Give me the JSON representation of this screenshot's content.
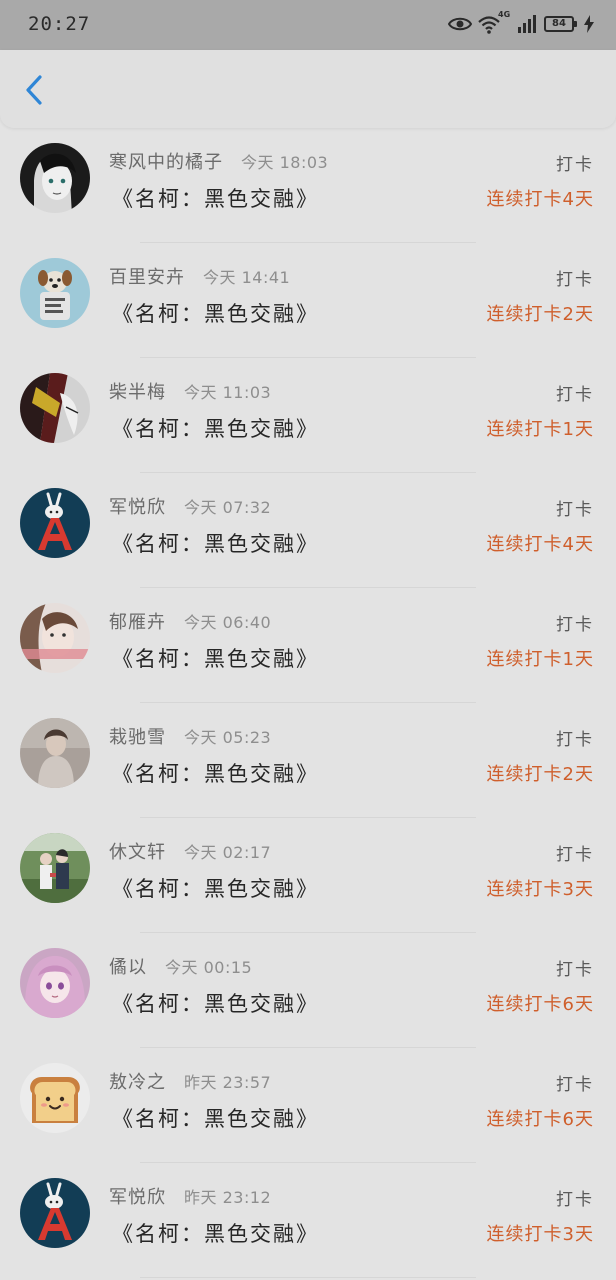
{
  "status_bar": {
    "time": "20:27",
    "network": "4G",
    "battery": "84",
    "icons": [
      "eye-icon",
      "wifi-icon",
      "signal-icon",
      "battery-icon",
      "charging-icon"
    ]
  },
  "header": {
    "back_icon": "chevron-left-icon",
    "accent_color": "#2f86d6"
  },
  "list": {
    "items": [
      {
        "name": "寒风中的橘子",
        "time": "今天 18:03",
        "book": "《名柯：黑色交融》",
        "action": "打卡",
        "streak": "连续打卡4天",
        "avatar": "avatar-anime-dark-hair"
      },
      {
        "name": "百里安卉",
        "time": "今天 14:41",
        "book": "《名柯：黑色交融》",
        "action": "打卡",
        "streak": "连续打卡2天",
        "avatar": "avatar-dog"
      },
      {
        "name": "柴半梅",
        "time": "今天 11:03",
        "book": "《名柯：黑色交融》",
        "action": "打卡",
        "streak": "连续打卡1天",
        "avatar": "avatar-mask-art"
      },
      {
        "name": "军悦欣",
        "time": "今天 07:32",
        "book": "《名柯：黑色交融》",
        "action": "打卡",
        "streak": "连续打卡4天",
        "avatar": "avatar-letter-a"
      },
      {
        "name": "郁雁卉",
        "time": "今天 06:40",
        "book": "《名柯：黑色交融》",
        "action": "打卡",
        "streak": "连续打卡1天",
        "avatar": "avatar-girl-pink"
      },
      {
        "name": "栽驰雪",
        "time": "今天 05:23",
        "book": "《名柯：黑色交融》",
        "action": "打卡",
        "streak": "连续打卡2天",
        "avatar": "avatar-girl-photo"
      },
      {
        "name": "休文轩",
        "time": "今天 02:17",
        "book": "《名柯：黑色交融》",
        "action": "打卡",
        "streak": "连续打卡3天",
        "avatar": "avatar-couple"
      },
      {
        "name": "僪以",
        "time": "今天 00:15",
        "book": "《名柯：黑色交融》",
        "action": "打卡",
        "streak": "连续打卡6天",
        "avatar": "avatar-anime-pink-hair"
      },
      {
        "name": "敖冷之",
        "time": "昨天 23:57",
        "book": "《名柯：黑色交融》",
        "action": "打卡",
        "streak": "连续打卡6天",
        "avatar": "avatar-toast"
      },
      {
        "name": "军悦欣",
        "time": "昨天 23:12",
        "book": "《名柯：黑色交融》",
        "action": "打卡",
        "streak": "连续打卡3天",
        "avatar": "avatar-letter-a"
      }
    ]
  },
  "colors": {
    "streak": "#cf5f2c",
    "background": "#e3e3e3",
    "status_bar": "#a9a9a9"
  }
}
